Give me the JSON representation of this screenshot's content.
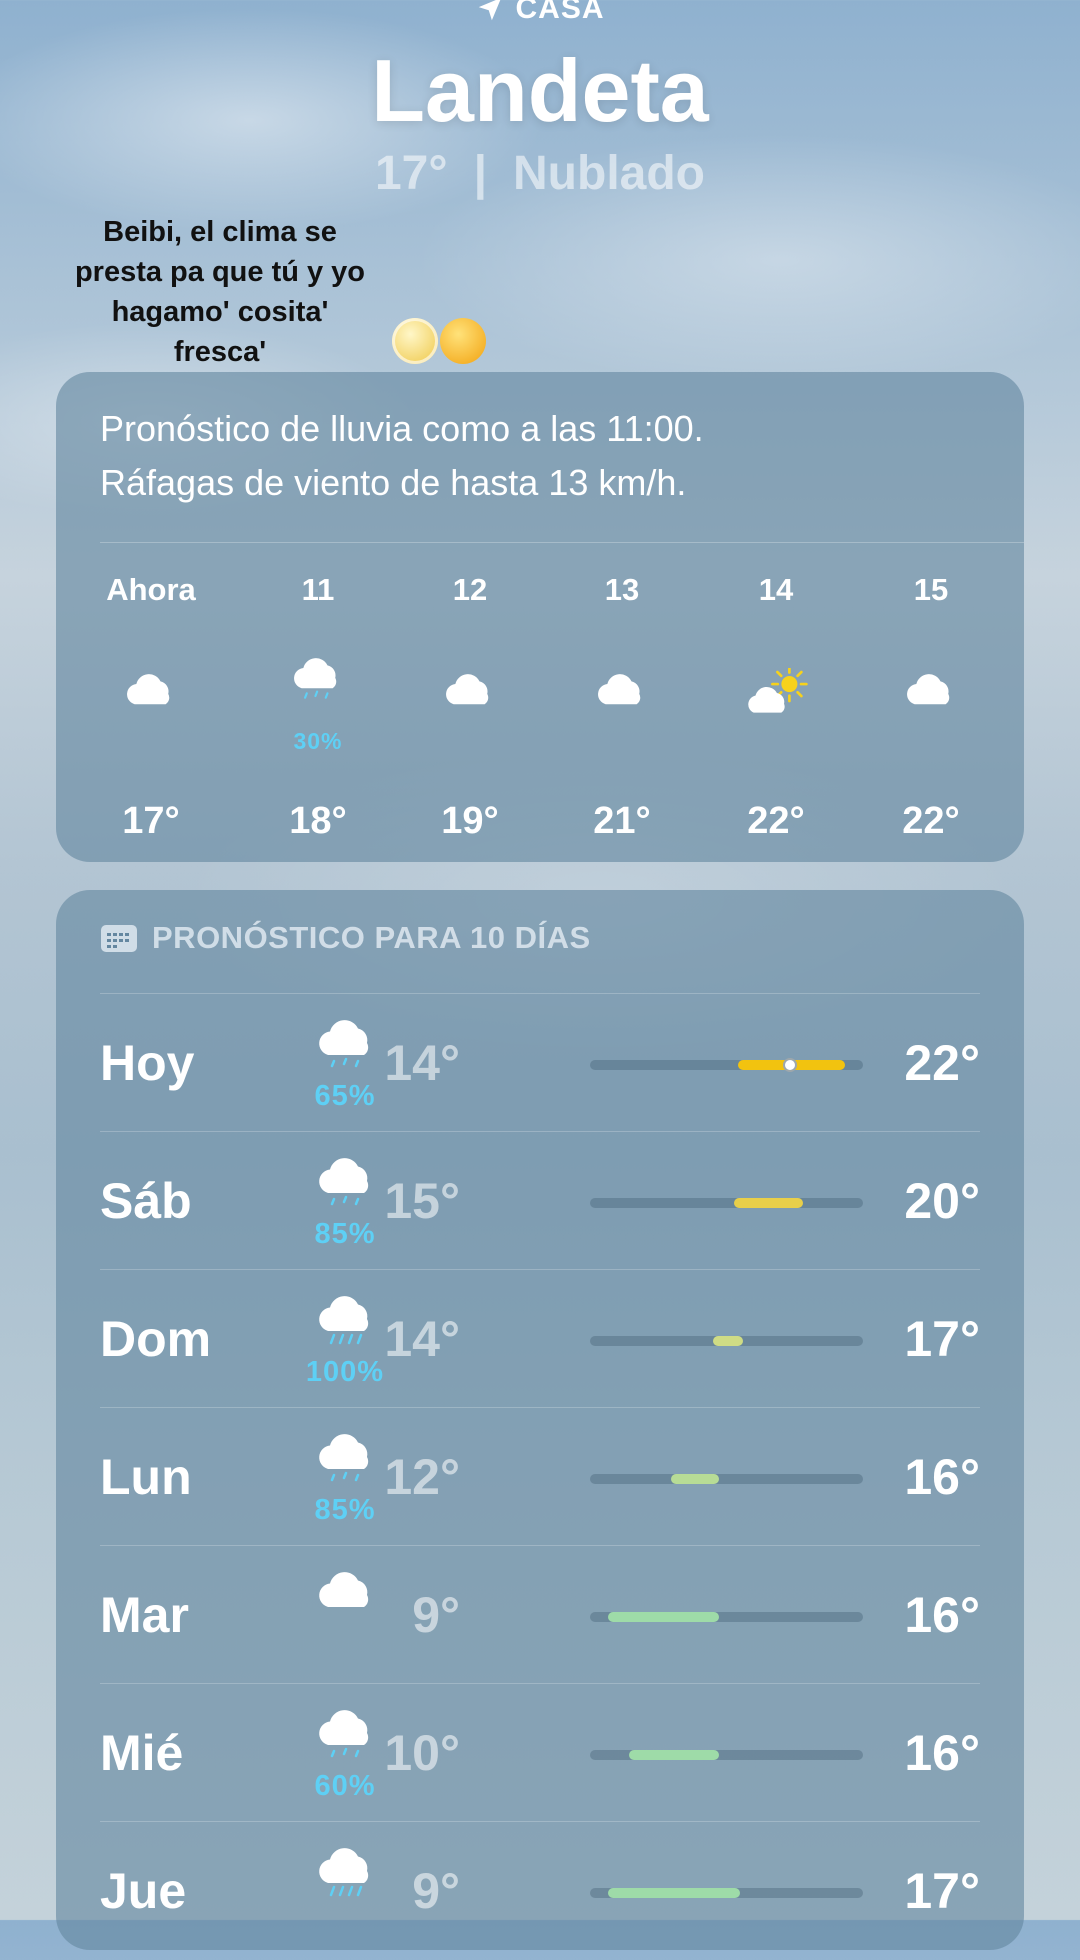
{
  "header": {
    "location_label": "CASA",
    "city": "Landeta",
    "current_temp": "17°",
    "divider": "|",
    "condition": "Nublado"
  },
  "caption": {
    "lines": [
      "Beibi, el clima se",
      "presta pa que tú y yo",
      "hagamo' cosita'",
      "fresca'"
    ]
  },
  "hourly_card": {
    "summary_line1": "Pronóstico de lluvia como a las 11:00.",
    "summary_line2": "Ráfagas de viento de hasta 13 km/h.",
    "hours": [
      {
        "label": "Ahora",
        "icon": "cloud-icon",
        "pct": "",
        "temp": "17°"
      },
      {
        "label": "11",
        "icon": "cloud-rain-icon",
        "pct": "30%",
        "temp": "18°"
      },
      {
        "label": "12",
        "icon": "cloud-icon",
        "pct": "",
        "temp": "19°"
      },
      {
        "label": "13",
        "icon": "cloud-icon",
        "pct": "",
        "temp": "21°"
      },
      {
        "label": "14",
        "icon": "cloud-sun-icon",
        "pct": "",
        "temp": "22°"
      },
      {
        "label": "15",
        "icon": "cloud-icon",
        "pct": "",
        "temp": "22°"
      }
    ]
  },
  "daily_card": {
    "title": "PRONÓSTICO PARA 10 DÍAS",
    "title_icon": "calendar-icon",
    "range_min": 9,
    "range_max": 22,
    "current_temp": 17,
    "days": [
      {
        "day": "Hoy",
        "icon": "cloud-rain-icon",
        "pct": "65%",
        "lo": "14°",
        "hi": "22°",
        "lo_val": 14,
        "hi_val": 22,
        "color": "#f2c30f"
      },
      {
        "day": "Sáb",
        "icon": "cloud-rain-icon",
        "pct": "85%",
        "lo": "15°",
        "hi": "20°",
        "lo_val": 15,
        "hi_val": 20,
        "color": "#e8cf4a"
      },
      {
        "day": "Dom",
        "icon": "cloud-rain-heavy-icon",
        "pct": "100%",
        "lo": "14°",
        "hi": "17°",
        "lo_val": 14,
        "hi_val": 17,
        "color": "#cfdc85"
      },
      {
        "day": "Lun",
        "icon": "cloud-rain-icon",
        "pct": "85%",
        "lo": "12°",
        "hi": "16°",
        "lo_val": 12,
        "hi_val": 16,
        "color": "#b7dc96"
      },
      {
        "day": "Mar",
        "icon": "cloud-icon",
        "pct": "",
        "lo": "9°",
        "hi": "16°",
        "lo_val": 9,
        "hi_val": 16,
        "color": "#9edba8"
      },
      {
        "day": "Mié",
        "icon": "cloud-rain-icon",
        "pct": "60%",
        "lo": "10°",
        "hi": "16°",
        "lo_val": 10,
        "hi_val": 16,
        "color": "#9edba8"
      },
      {
        "day": "Jue",
        "icon": "cloud-rain-heavy-icon",
        "pct": "",
        "lo": "9°",
        "hi": "17°",
        "lo_val": 9,
        "hi_val": 17,
        "color": "#9edba8"
      }
    ]
  }
}
